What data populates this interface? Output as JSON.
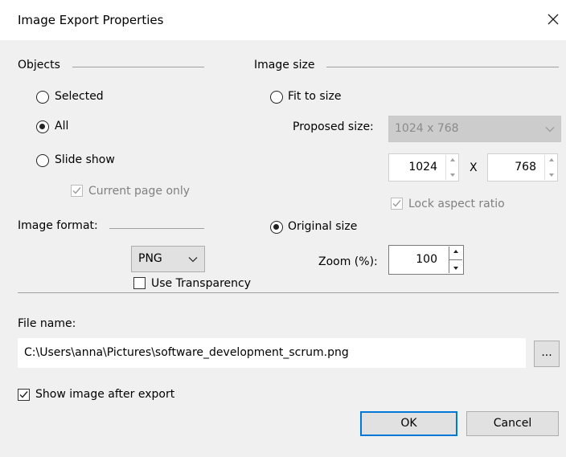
{
  "window": {
    "title": "Image Export Properties",
    "close_label": "close"
  },
  "objects": {
    "heading": "Objects",
    "options": [
      "Selected",
      "All",
      "Slide show"
    ],
    "selected_index": 1,
    "current_page_only_label": "Current page only",
    "current_page_only_checked": true,
    "current_page_only_enabled": false
  },
  "image_size": {
    "heading": "Image size",
    "fit_to_size_label": "Fit to size",
    "fit_to_size_selected": false,
    "proposed_size_label": "Proposed size:",
    "proposed_size_value": "1024 x 768",
    "width_value": "1024",
    "separator_x": "X",
    "height_value": "768",
    "lock_aspect_label": "Lock aspect ratio",
    "lock_aspect_checked": true,
    "original_size_label": "Original size",
    "original_size_selected": true,
    "zoom_label": "Zoom (%):",
    "zoom_value": "100"
  },
  "image_format": {
    "heading": "Image format:",
    "format_value": "PNG",
    "use_transparency_label": "Use Transparency",
    "use_transparency_checked": false
  },
  "file": {
    "label": "File name:",
    "path": "C:\\Users\\anna\\Pictures\\software_development_scrum.png",
    "browse_label": "..."
  },
  "show_after_export": {
    "label": "Show image after export",
    "checked": true
  },
  "buttons": {
    "ok_label": "OK",
    "cancel_label": "Cancel"
  },
  "colors": {
    "dialog_bg": "#f0f0f0",
    "title_bg": "#ffffff",
    "focus_border": "#0078d7",
    "disabled_text": "#808080"
  }
}
